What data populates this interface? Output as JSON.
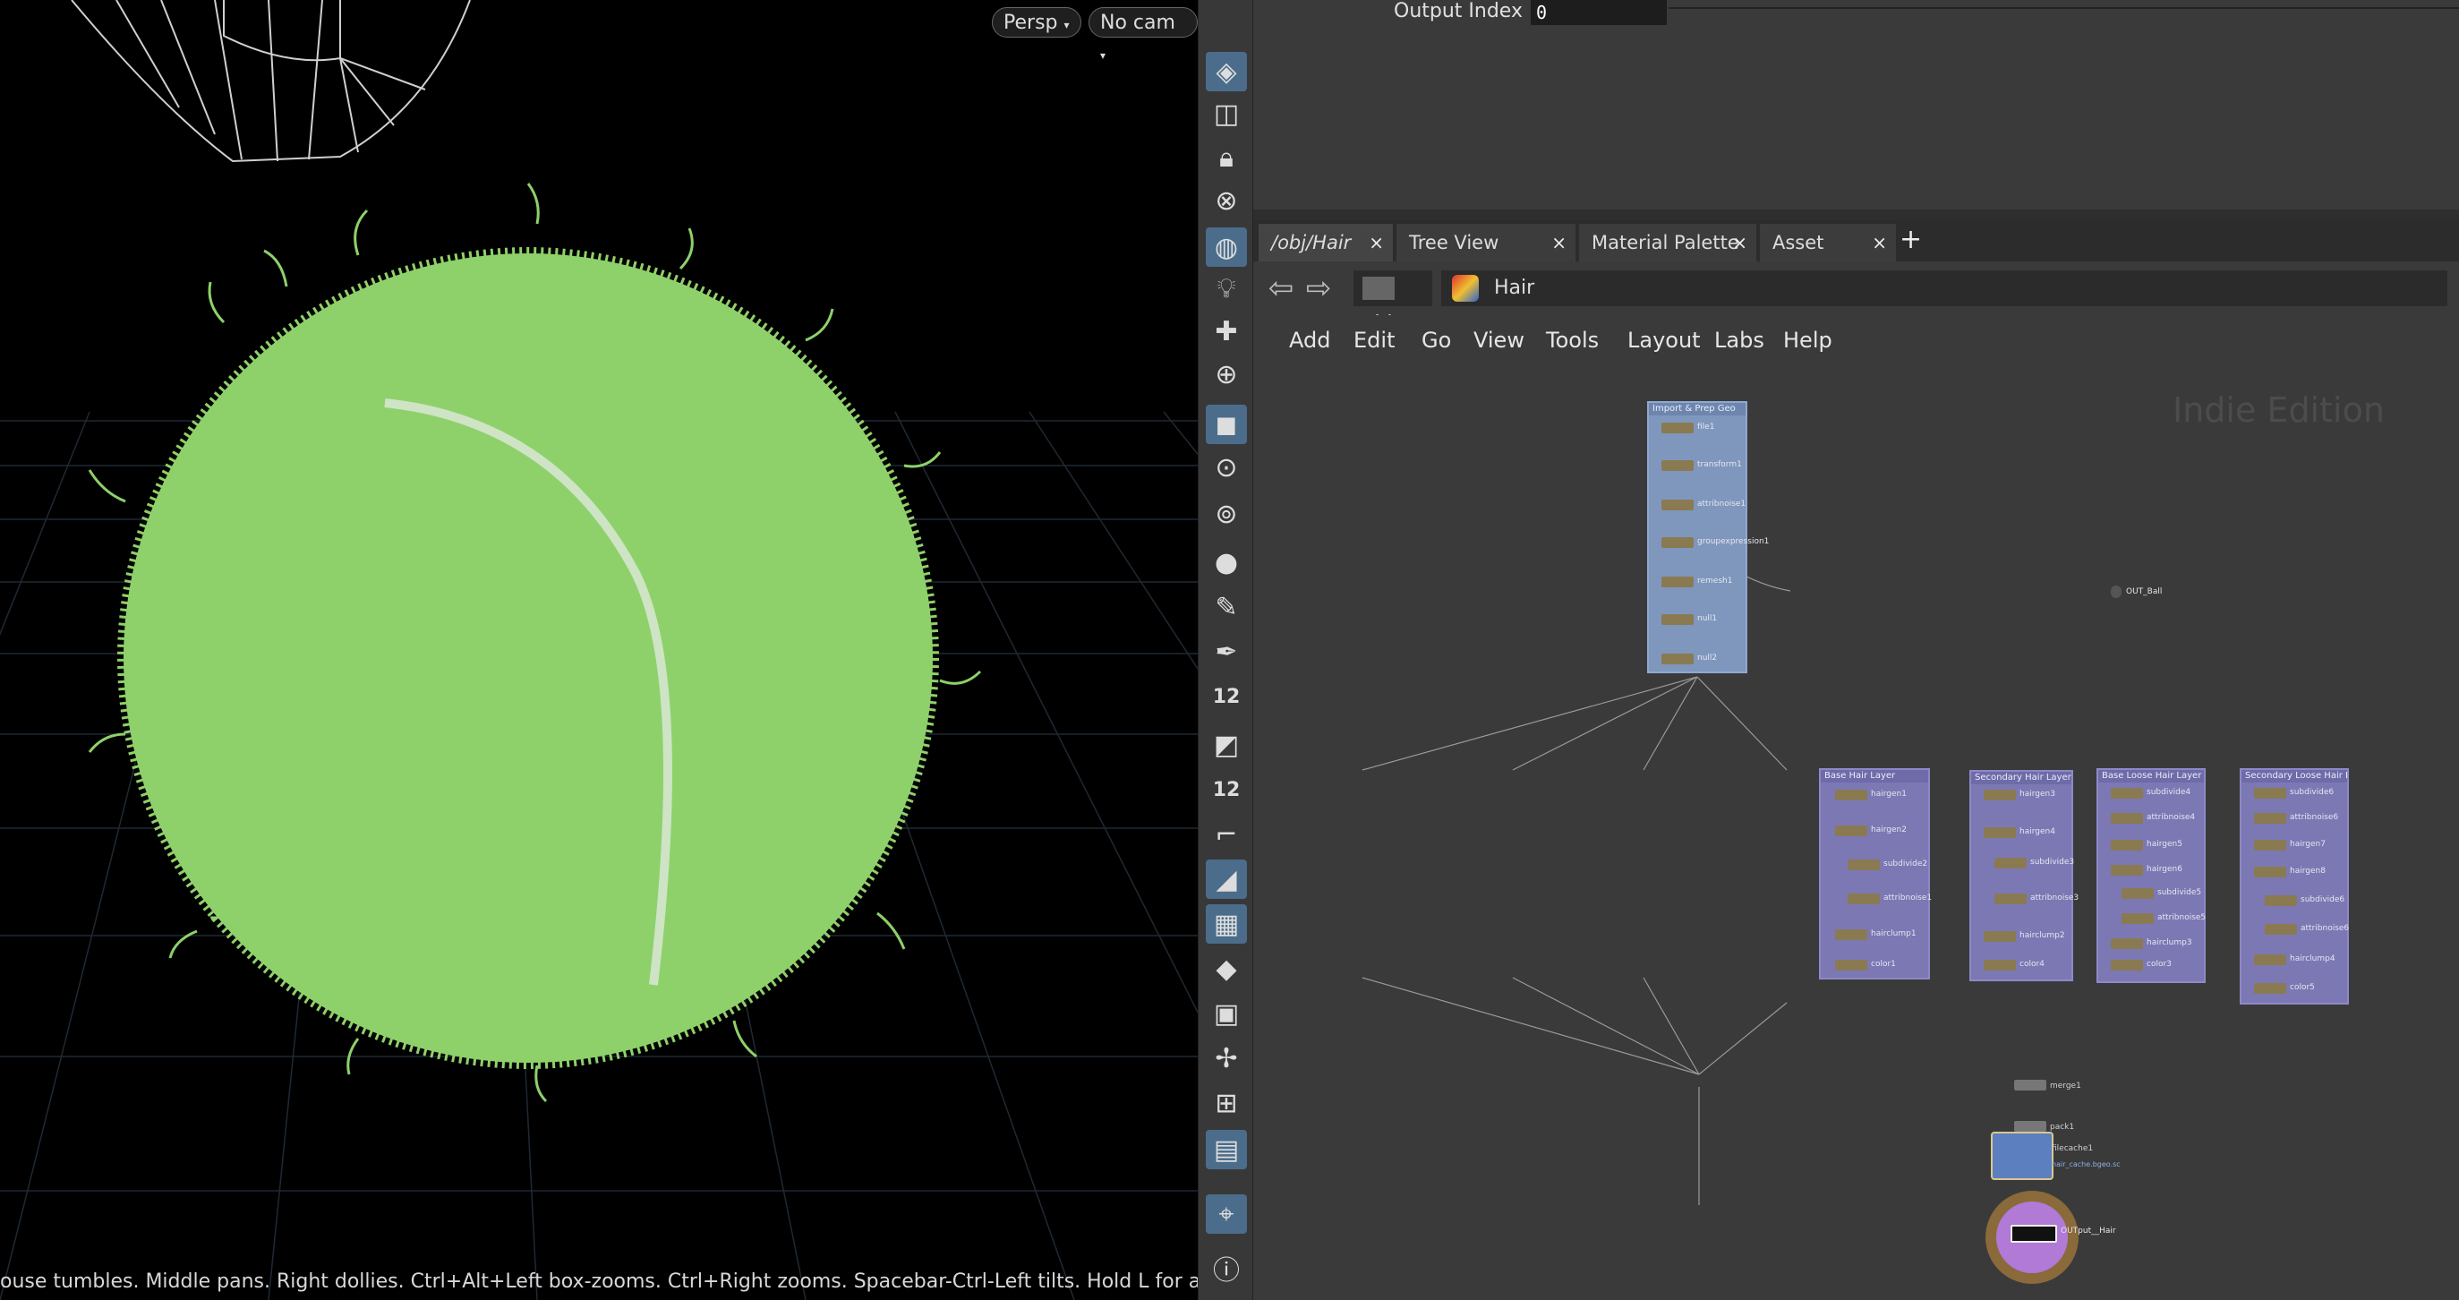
{
  "viewport": {
    "persp_label": "Persp",
    "cam_label": "No cam",
    "status_text": "ouse tumbles. Middle pans. Right dollies. Ctrl+Alt+Left box-zooms. Ctrl+Right zooms. Spacebar-Ctrl-Left tilts. Hold L for alternate",
    "colors": {
      "ball": "#8ed16a",
      "background": "#000000",
      "grid": "#2a3440"
    }
  },
  "toolbar": {
    "items": [
      {
        "icon": "layers-icon"
      },
      {
        "icon": "snap-icon"
      },
      {
        "icon": "lock-icon"
      },
      {
        "icon": "ghost-icon"
      },
      {
        "icon": "display-icon"
      },
      {
        "icon": "light-icon"
      },
      {
        "icon": "light-add-icon"
      },
      {
        "icon": "light-target-icon"
      },
      {
        "icon": "shading-icon"
      },
      {
        "icon": "camera-icon"
      },
      {
        "icon": "camera-view-icon"
      },
      {
        "icon": "point-icon"
      },
      {
        "icon": "brush-icon"
      },
      {
        "icon": "pen-icon"
      },
      {
        "icon": "point-number-icon",
        "text": "12"
      },
      {
        "icon": "primitive-icon"
      },
      {
        "icon": "primitive-number-icon",
        "text": "12"
      },
      {
        "icon": "curve-icon"
      },
      {
        "icon": "pivot-icon"
      },
      {
        "icon": "checker-icon"
      },
      {
        "icon": "diamond-icon"
      },
      {
        "icon": "uv-icon"
      },
      {
        "icon": "handle-icon"
      },
      {
        "icon": "grid-select-icon"
      },
      {
        "icon": "background-image-icon"
      },
      {
        "icon": "pin-icon"
      },
      {
        "icon": "info-icon"
      }
    ]
  },
  "parameters": {
    "output_index_label": "Output Index",
    "output_index_value": "0"
  },
  "tabs": [
    {
      "label": "/obj/Hair",
      "close": "×"
    },
    {
      "label": "Tree View",
      "close": "×"
    },
    {
      "label": "Material Palette",
      "close": "×"
    },
    {
      "label": "Asset Browser",
      "close": "×"
    }
  ],
  "add_tab": "+",
  "path": {
    "back": "⇦",
    "forward": "⇨",
    "obj_label": "obj",
    "hair_label": "Hair"
  },
  "menu": [
    "Add",
    "Edit",
    "Go",
    "View",
    "Tools",
    "Layout",
    "Labs",
    "Help"
  ],
  "network": {
    "watermark": "Indie Edition",
    "boxes": [
      {
        "title": "Import & Prep Geo",
        "nodes": [
          "file1",
          "transform1",
          "attribnoise1",
          "groupexpression1",
          "remesh1",
          "null1",
          "null2"
        ]
      },
      {
        "title": "Base Hair Layer",
        "nodes": [
          "hairgen1",
          "hairgen2",
          "subdivide2",
          "attribnoise1",
          "hairclump1",
          "color1"
        ]
      },
      {
        "title": "Secondary Hair Layer",
        "nodes": [
          "hairgen3",
          "hairgen4",
          "subdivide3",
          "attribnoise3",
          "hairclump2",
          "color4"
        ]
      },
      {
        "title": "Base Loose Hair Layer",
        "nodes": [
          "subdivide4",
          "attribnoise4",
          "hairgen5",
          "hairgen6",
          "subdivide5",
          "attribnoise5",
          "hairclump3",
          "color3"
        ]
      },
      {
        "title": "Secondary Loose Hair La...",
        "nodes": [
          "subdivide6",
          "attribnoise6",
          "hairgen7",
          "hairgen8",
          "subdivide6",
          "attribnoise6",
          "hairclump4",
          "color5"
        ]
      }
    ],
    "out_ball": "OUT_Ball",
    "merge": "merge1",
    "pack": "pack1",
    "filecache": "filecache1",
    "filecache_path": "hair_cache.bgeo.sc",
    "output": "OUTput__Hair"
  }
}
